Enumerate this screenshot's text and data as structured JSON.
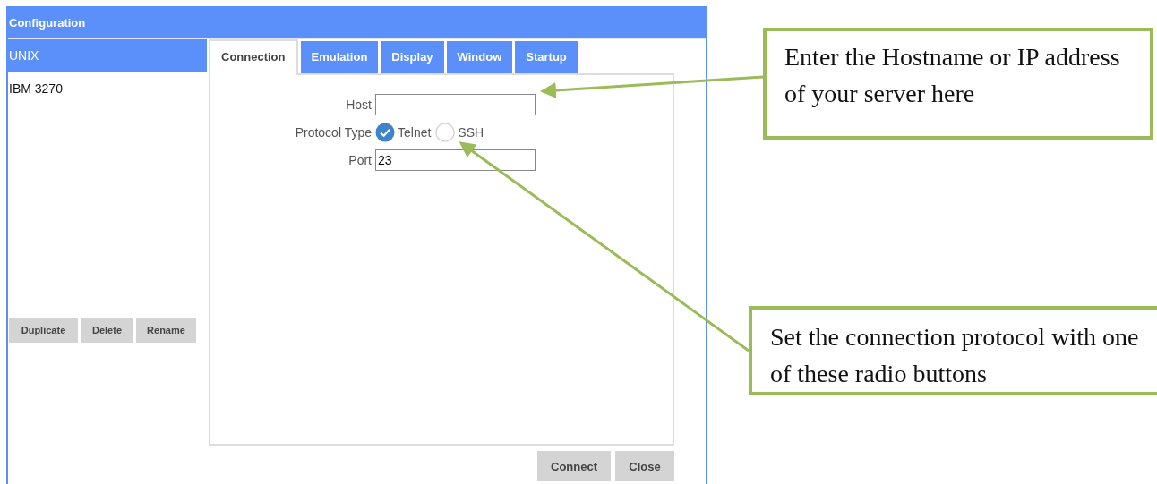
{
  "window": {
    "title": "Configuration"
  },
  "sidebar": {
    "items": [
      {
        "label": "UNIX",
        "selected": true
      },
      {
        "label": "IBM 3270",
        "selected": false
      }
    ],
    "buttons": [
      "Duplicate",
      "Delete",
      "Rename"
    ]
  },
  "tabs": [
    {
      "label": "Connection",
      "selected": true
    },
    {
      "label": "Emulation",
      "selected": false
    },
    {
      "label": "Display",
      "selected": false
    },
    {
      "label": "Window",
      "selected": false
    },
    {
      "label": "Startup",
      "selected": false
    }
  ],
  "form": {
    "host": {
      "label": "Host"
    },
    "protocol": {
      "label": "Protocol Type",
      "options": [
        {
          "label": "Telnet",
          "selected": true
        },
        {
          "label": "SSH",
          "selected": false
        }
      ]
    },
    "port": {
      "label": "Port",
      "value": "23"
    }
  },
  "buttons": [
    "Connect",
    "Close"
  ],
  "callouts": [
    {
      "text": "Enter the Hostname or IP address of your server here"
    },
    {
      "text": "Set the connection protocol with one of these radio buttons"
    }
  ]
}
